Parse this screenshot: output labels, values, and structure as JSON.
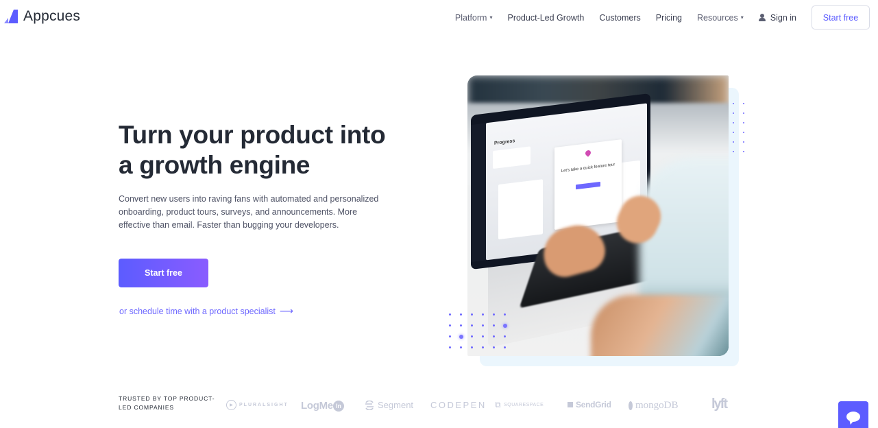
{
  "header": {
    "brand": "Appcues",
    "brand_color": "#5c5cff",
    "nav": [
      {
        "label": "Platform",
        "has_dropdown": true
      },
      {
        "label": "Product-Led Growth",
        "has_dropdown": false
      },
      {
        "label": "Customers",
        "has_dropdown": false
      },
      {
        "label": "Pricing",
        "has_dropdown": false
      },
      {
        "label": "Resources",
        "has_dropdown": true
      }
    ],
    "sign_in": "Sign in",
    "cta": "Start free",
    "dropdown_glyph": "▾"
  },
  "hero": {
    "title_line1": "Turn your product into",
    "title_line2": "a growth engine",
    "subtitle": "Convert new users into raving fans with automated and personalized onboarding, product tours, surveys, and announcements. More effective than email. Faster than bugging your developers.",
    "cta": "Start free",
    "schedule_link": "or schedule time with a product specialist",
    "arrow_glyph": "⟶",
    "image": {
      "screen_title": "Progress",
      "modal_text": "Let's take a quick feature tour"
    }
  },
  "logos": {
    "heading": "TRUSTED BY TOP PRODUCT-LED COMPANIES",
    "items": [
      "PLURALSIGHT",
      "LogMeIn",
      "Segment",
      "CODEPEN",
      "SQUARESPACE",
      "SendGrid",
      "mongoDB",
      "lyft"
    ]
  },
  "chat": {
    "icon": "chat-bubble-icon"
  }
}
